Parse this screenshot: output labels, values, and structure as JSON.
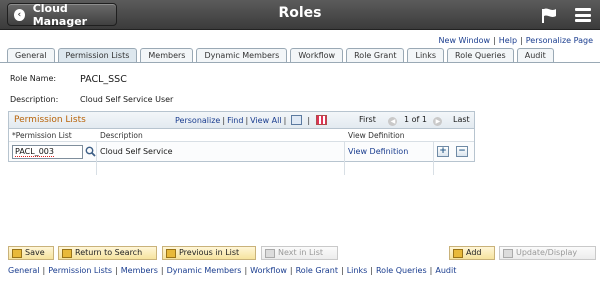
{
  "header": {
    "back_label": "Cloud Manager",
    "title": "Roles"
  },
  "top_links": [
    "New Window",
    "Help",
    "Personalize Page"
  ],
  "tabs": [
    "General",
    "Permission Lists",
    "Members",
    "Dynamic Members",
    "Workflow",
    "Role Grant",
    "Links",
    "Role Queries",
    "Audit"
  ],
  "active_tab": "Permission Lists",
  "role_name": {
    "label": "Role Name:",
    "value": "PACL_SSC"
  },
  "description": {
    "label": "Description:",
    "value": "Cloud Self Service User"
  },
  "grid": {
    "title": "Permission Lists",
    "personalize": "Personalize",
    "find": "Find",
    "view_all": "View All",
    "first": "First",
    "range": "1 of 1",
    "last": "Last",
    "columns": [
      "*Permission List",
      "Description",
      "View Definition"
    ],
    "rows": [
      {
        "permission_list": "PACL_003",
        "description": "Cloud Self Service",
        "view_definition": "View Definition"
      }
    ]
  },
  "buttons": {
    "save": "Save",
    "return_to_search": "Return to Search",
    "previous_in_list": "Previous in List",
    "next_in_list": "Next in List",
    "add": "Add",
    "update_display": "Update/Display"
  },
  "bottom_links": [
    "General",
    "Permission Lists",
    "Members",
    "Dynamic Members",
    "Workflow",
    "Role Grant",
    "Links",
    "Role Queries",
    "Audit"
  ]
}
